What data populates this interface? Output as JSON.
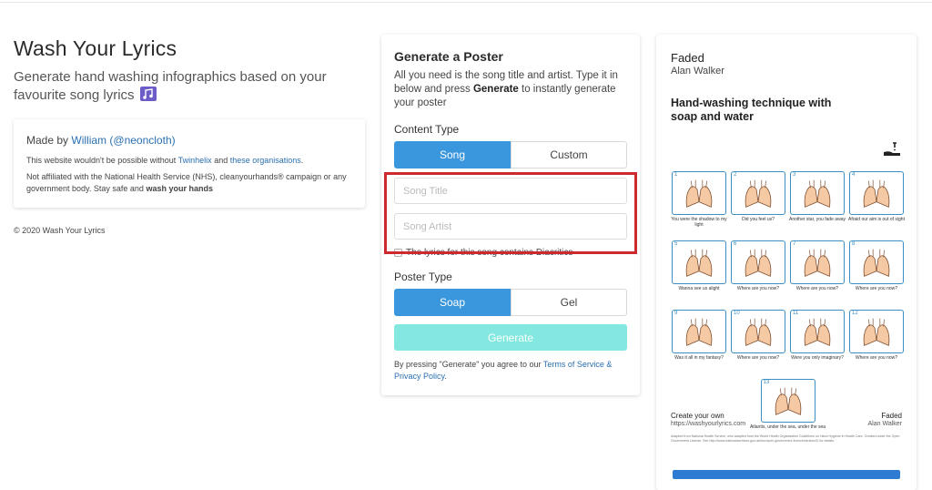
{
  "header": {
    "title": "Wash Your Lyrics",
    "subtitle": "Generate hand washing infographics based on your favourite song lyrics"
  },
  "made_by": {
    "prefix": "Made by",
    "author": "William",
    "handle": "(@neoncloth)",
    "line1_prefix": "This website wouldn't be possible without",
    "twinhelix": "Twinhelix",
    "and": "and",
    "orgs": "these organisations",
    "line2": "Not affiliated with the National Health Service (NHS), cleanyourhands® campaign or any government body. Stay safe and",
    "line2_bold": "wash your hands"
  },
  "footer": {
    "copyright": "© 2020 Wash Your Lyrics"
  },
  "generator": {
    "title": "Generate a Poster",
    "desc_prefix": "All you need is the song title and artist. Type it in below and press",
    "desc_bold": "Generate",
    "desc_suffix": "to instantly generate your poster",
    "content_type_label": "Content Type",
    "content_types": [
      "Song",
      "Custom"
    ],
    "song_title_placeholder": "Song Title",
    "song_artist_placeholder": "Song Artist",
    "diacritics_label": "The lyrics for this song contains Diacritics",
    "poster_type_label": "Poster Type",
    "poster_types": [
      "Soap",
      "Gel"
    ],
    "generate_label": "Generate",
    "terms_prefix": "By pressing \"Generate\" you agree to our",
    "terms_link": "Terms of Service & Privacy Policy",
    "terms_suffix": "."
  },
  "poster": {
    "song": "Faded",
    "artist": "Alan Walker",
    "heading": "Hand-washing technique with soap and water",
    "steps": [
      {
        "n": "1",
        "caption": "You were the shadow to my light"
      },
      {
        "n": "2",
        "caption": "Did you feel us?"
      },
      {
        "n": "3",
        "caption": "Another star, you fade away"
      },
      {
        "n": "4",
        "caption": "Afraid our aim is out of sight"
      },
      {
        "n": "5",
        "caption": "Wanna see us alight"
      },
      {
        "n": "6",
        "caption": "Where are you now?"
      },
      {
        "n": "7",
        "caption": "Where are you now?"
      },
      {
        "n": "8",
        "caption": "Where are you now?"
      },
      {
        "n": "9",
        "caption": "Was it all in my fantasy?"
      },
      {
        "n": "10",
        "caption": "Where are you now?"
      },
      {
        "n": "11",
        "caption": "Were you only imaginary?"
      },
      {
        "n": "12",
        "caption": "Where are you now?"
      },
      {
        "n": "13",
        "caption": "Atlantis, under the sea, under the sea"
      }
    ],
    "create_own": "Create your own",
    "url": "https://washyourlyrics.com",
    "foot_song": "Faded",
    "foot_artist": "Alan Walker",
    "fine_print": "Adapted from National Health Service, who adapted from the World Health Organization Guidelines on Hand Hygiene in Health Care. Created under the Open Government License. See http://www.nationalarchives.gov.uk/doc/open-government-licence/version/3/ for details."
  },
  "colors": {
    "accent": "#3b97dd",
    "generate_disabled": "#83e8df",
    "highlight": "#cc2a2f",
    "link": "#2a6fb0"
  }
}
